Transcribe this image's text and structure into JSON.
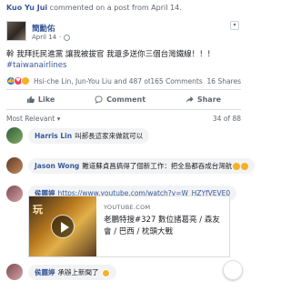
{
  "header": {
    "actor": "Kuo Yu Jui",
    "action": " commented on a post from April 14."
  },
  "post": {
    "author": "簡勳佑",
    "date": "April 14",
    "text": "幹 我拜託民進黨 讓我被拔官 我還多送你三個台灣鐵線！！！",
    "hashtag": "#taiwanairlines",
    "reaction_names": "Hsi-che Lin, Jun-You Liu and 487 others",
    "comments_count": "165 Comments",
    "shares_count": "16 Shares"
  },
  "actions": {
    "like": "Like",
    "comment": "Comment",
    "share": "Share"
  },
  "sort": {
    "label": "Most Relevant",
    "pager": "34 of 88"
  },
  "comments": [
    {
      "name": "Harris Lin",
      "text": "叫郝長這家來做就可以"
    },
    {
      "name": "Jason Wong",
      "text": "難道蘇貞昌搞得了個新工作：把全島都吞成台灣航"
    },
    {
      "name": "侯麗婷",
      "text": "https://www.youtube.com/watch?v=W_HZYfVEVE0"
    },
    {
      "name": "侯麗婷",
      "text": "承辦上新聞了"
    }
  ],
  "link_card": {
    "thumb_text": "玩",
    "site": "YOUTUBE.COM",
    "title": "老鵬特搜#327 數位諸葛亮 / 森友會 / 巴西 / 枕頭大戰"
  },
  "colors": {
    "link": "#385898",
    "like": "#2078f4",
    "love": "#f33e58",
    "haha": "#f7b125"
  }
}
